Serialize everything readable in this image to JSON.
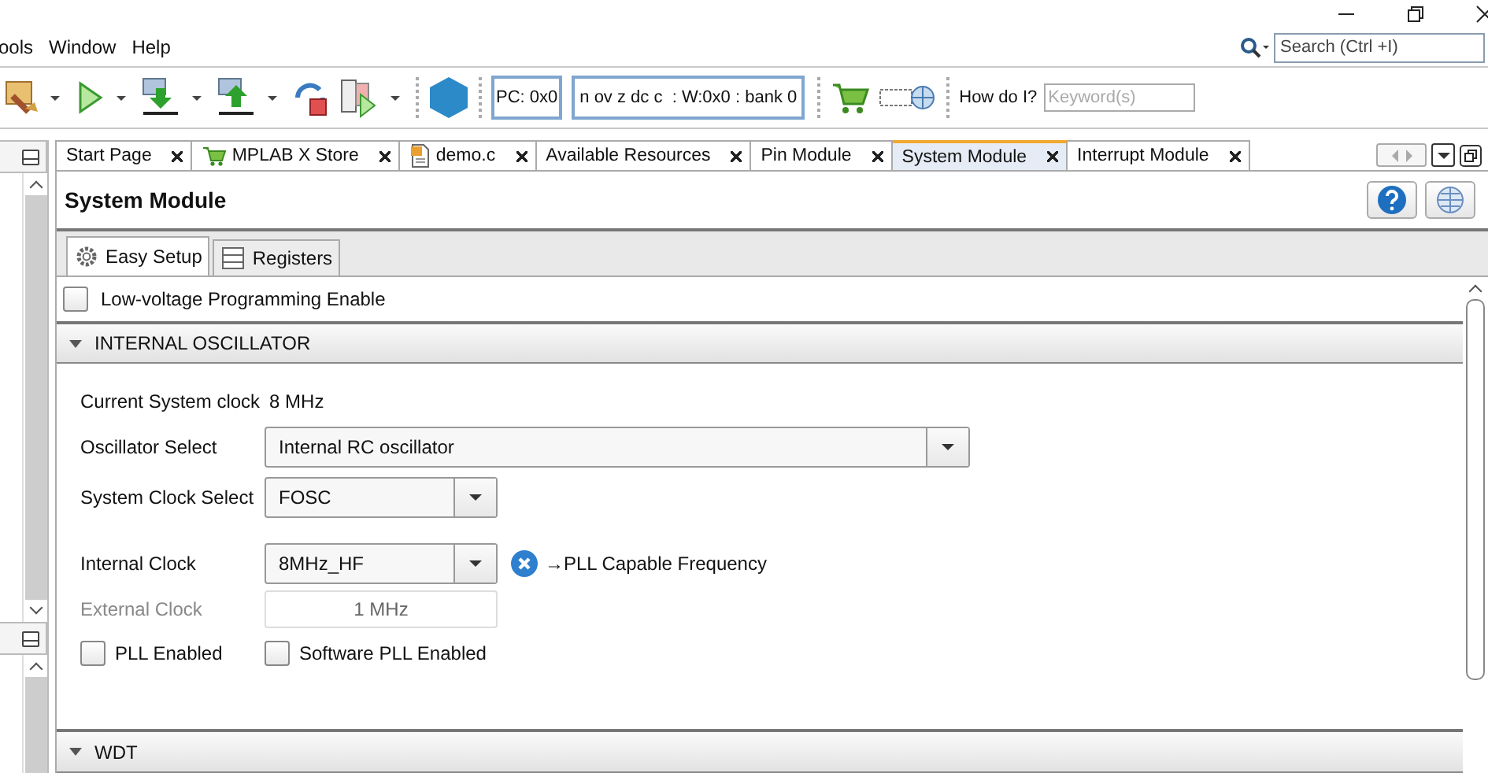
{
  "menu": [
    "ools",
    "Window",
    "Help"
  ],
  "search": {
    "placeholder": "Search (Ctrl +I)"
  },
  "toolbar": {
    "pc": "PC: 0x0",
    "status": "n ov z dc c  : W:0x0 : bank 0",
    "how_label": "How do I?",
    "keyword_placeholder": "Keyword(s)"
  },
  "tabs": [
    {
      "label": "Start Page",
      "selected": false
    },
    {
      "label": "MPLAB X Store",
      "selected": false
    },
    {
      "label": "demo.c",
      "selected": false
    },
    {
      "label": "Available Resources",
      "selected": false
    },
    {
      "label": "Pin Module",
      "selected": false
    },
    {
      "label": "System Module",
      "selected": true
    },
    {
      "label": "Interrupt Module",
      "selected": false
    }
  ],
  "panel": {
    "title": "System Module",
    "subtabs": [
      {
        "label": "Easy Setup",
        "selected": true
      },
      {
        "label": "Registers",
        "selected": false
      }
    ],
    "low_voltage": {
      "label": "Low-voltage Programming Enable",
      "checked": false
    },
    "sections": [
      {
        "title": "INTERNAL OSCILLATOR",
        "rows": [
          {
            "kind": "info",
            "label": "Current System clock",
            "value": "8 MHz"
          },
          {
            "kind": "select",
            "label": "Oscillator Select",
            "value": "Internal RC oscillator"
          },
          {
            "kind": "select",
            "label": "System Clock Select",
            "value": "FOSC"
          },
          {
            "kind": "select",
            "label": "Internal Clock",
            "value": "8MHz_HF",
            "note": "→PLL Capable Frequency"
          },
          {
            "kind": "text",
            "label": "External Clock",
            "value": "1 MHz",
            "disabled": true
          },
          {
            "kind": "checks",
            "items": [
              {
                "label": "PLL Enabled",
                "checked": false
              },
              {
                "label": "Software PLL Enabled",
                "checked": false
              }
            ]
          }
        ]
      },
      {
        "title": "WDT"
      }
    ]
  }
}
